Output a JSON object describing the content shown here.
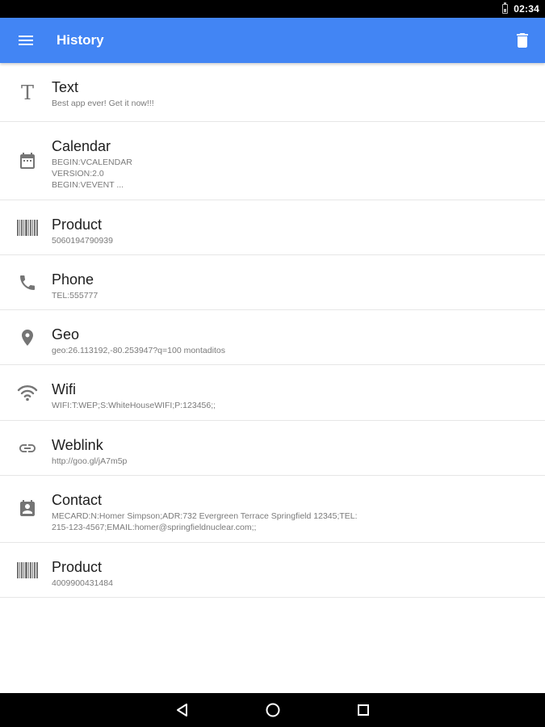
{
  "status_bar": {
    "time": "02:34"
  },
  "app_bar": {
    "title": "History",
    "menu_icon": "hamburger-menu-icon",
    "delete_icon": "trash-icon"
  },
  "history": [
    {
      "type_icon": "text-icon",
      "title": "Text",
      "subtitle": "Best app ever! Get it now!!!"
    },
    {
      "type_icon": "calendar-icon",
      "title": "Calendar",
      "subtitle": "BEGIN:VCALENDAR\nVERSION:2.0\nBEGIN:VEVENT ..."
    },
    {
      "type_icon": "barcode-icon",
      "title": "Product",
      "subtitle": "5060194790939"
    },
    {
      "type_icon": "phone-icon",
      "title": "Phone",
      "subtitle": "TEL:555777"
    },
    {
      "type_icon": "location-pin-icon",
      "title": "Geo",
      "subtitle": "geo:26.113192,-80.253947?q=100 montaditos"
    },
    {
      "type_icon": "wifi-icon",
      "title": "Wifi",
      "subtitle": "WIFI:T:WEP;S:WhiteHouseWIFI;P:123456;;"
    },
    {
      "type_icon": "link-icon",
      "title": "Weblink",
      "subtitle": "http://goo.gl/jA7m5p"
    },
    {
      "type_icon": "contact-card-icon",
      "title": "Contact",
      "subtitle": "MECARD:N:Homer Simpson;ADR:732 Evergreen Terrace Springfield 12345;TEL:\n215-123-4567;EMAIL:homer@springfieldnuclear.com;;"
    },
    {
      "type_icon": "barcode-icon",
      "title": "Product",
      "subtitle": "4009900431484"
    }
  ],
  "colors": {
    "app_bar": "#4285f4",
    "icon_gray": "#757575",
    "divider": "#e6e6e6"
  },
  "nav_bar": {
    "back_icon": "back-triangle-icon",
    "home_icon": "home-circle-icon",
    "recents_icon": "recents-square-icon"
  }
}
